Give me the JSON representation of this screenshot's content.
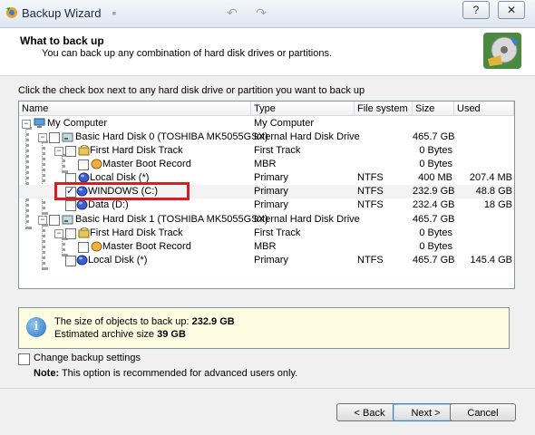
{
  "window": {
    "title": "Backup Wizard",
    "help_glyph": "?",
    "close_glyph": "✕"
  },
  "header": {
    "title": "What to back up",
    "subtitle": "You can back up any combination of hard disk drives or partitions."
  },
  "instruction": "Click the check box next to any hard disk drive or partition you want to back up",
  "table": {
    "columns": [
      "Name",
      "Type",
      "File system",
      "Size",
      "Used"
    ],
    "rows": [
      {
        "name": "My Computer",
        "type": "My Computer",
        "fs": "",
        "size": "",
        "used": ""
      },
      {
        "name": "Basic Hard Disk 0 (TOSHIBA MK5055GSX)",
        "type": "Internal Hard Disk Drive",
        "fs": "",
        "size": "465.7 GB",
        "used": ""
      },
      {
        "name": "First Hard Disk Track",
        "type": "First Track",
        "fs": "",
        "size": "0 Bytes",
        "used": ""
      },
      {
        "name": "Master Boot Record",
        "type": "MBR",
        "fs": "",
        "size": "0 Bytes",
        "used": ""
      },
      {
        "name": "Local Disk (*)",
        "type": "Primary",
        "fs": "NTFS",
        "size": "400 MB",
        "used": "207.4 MB"
      },
      {
        "name": "WINDOWS (C:)",
        "type": "Primary",
        "fs": "NTFS",
        "size": "232.9 GB",
        "used": "48.8 GB",
        "checked": true
      },
      {
        "name": "Data (D:)",
        "type": "Primary",
        "fs": "NTFS",
        "size": "232.4 GB",
        "used": "18 GB"
      },
      {
        "name": "Basic Hard Disk 1 (TOSHIBA MK5055GSX)",
        "type": "Internal Hard Disk Drive",
        "fs": "",
        "size": "465.7 GB",
        "used": ""
      },
      {
        "name": "First Hard Disk Track",
        "type": "First Track",
        "fs": "",
        "size": "0 Bytes",
        "used": ""
      },
      {
        "name": "Master Boot Record",
        "type": "MBR",
        "fs": "",
        "size": "0 Bytes",
        "used": ""
      },
      {
        "name": "Local Disk (*)",
        "type": "Primary",
        "fs": "NTFS",
        "size": "465.7 GB",
        "used": "145.4 GB"
      }
    ]
  },
  "info": {
    "line1_label": "The size of objects to back up: ",
    "line1_value": "232.9 GB",
    "line2_label": "Estimated archive size ",
    "line2_value": "39 GB"
  },
  "settings": {
    "change_label": "Change backup settings",
    "note_label": "Note:",
    "note_text": " This option is recommended for advanced users only."
  },
  "buttons": {
    "back": "< Back",
    "next": "Next >",
    "cancel": "Cancel"
  },
  "colors": {
    "highlight_box": "#d21f1f",
    "info_bg": "#fefce1"
  }
}
